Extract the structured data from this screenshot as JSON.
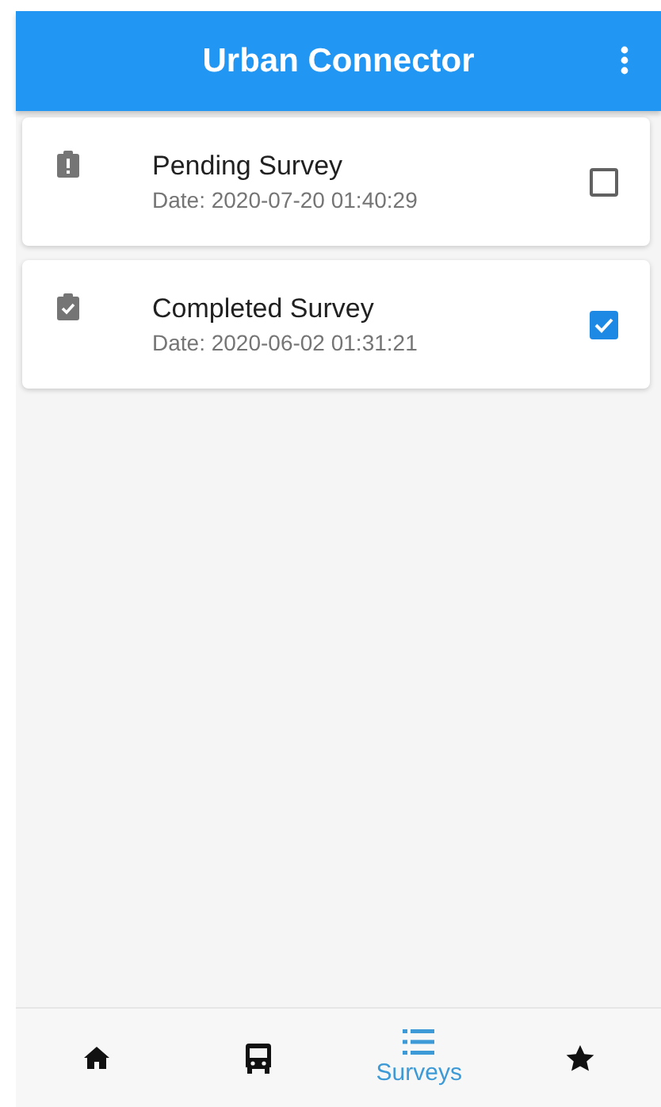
{
  "app_bar": {
    "title": "Urban Connector"
  },
  "surveys": [
    {
      "kind": "pending",
      "title": "Pending Survey",
      "date": "Date: 2020-07-20 01:40:29",
      "checked": false
    },
    {
      "kind": "completed",
      "title": "Completed Survey",
      "date": "Date: 2020-06-02 01:31:21",
      "checked": true
    }
  ],
  "bottom_nav": [
    {
      "kind": "home",
      "selected": false
    },
    {
      "kind": "bus",
      "selected": false
    },
    {
      "kind": "list",
      "selected": true,
      "label": "Surveys"
    },
    {
      "kind": "star",
      "selected": false
    }
  ]
}
